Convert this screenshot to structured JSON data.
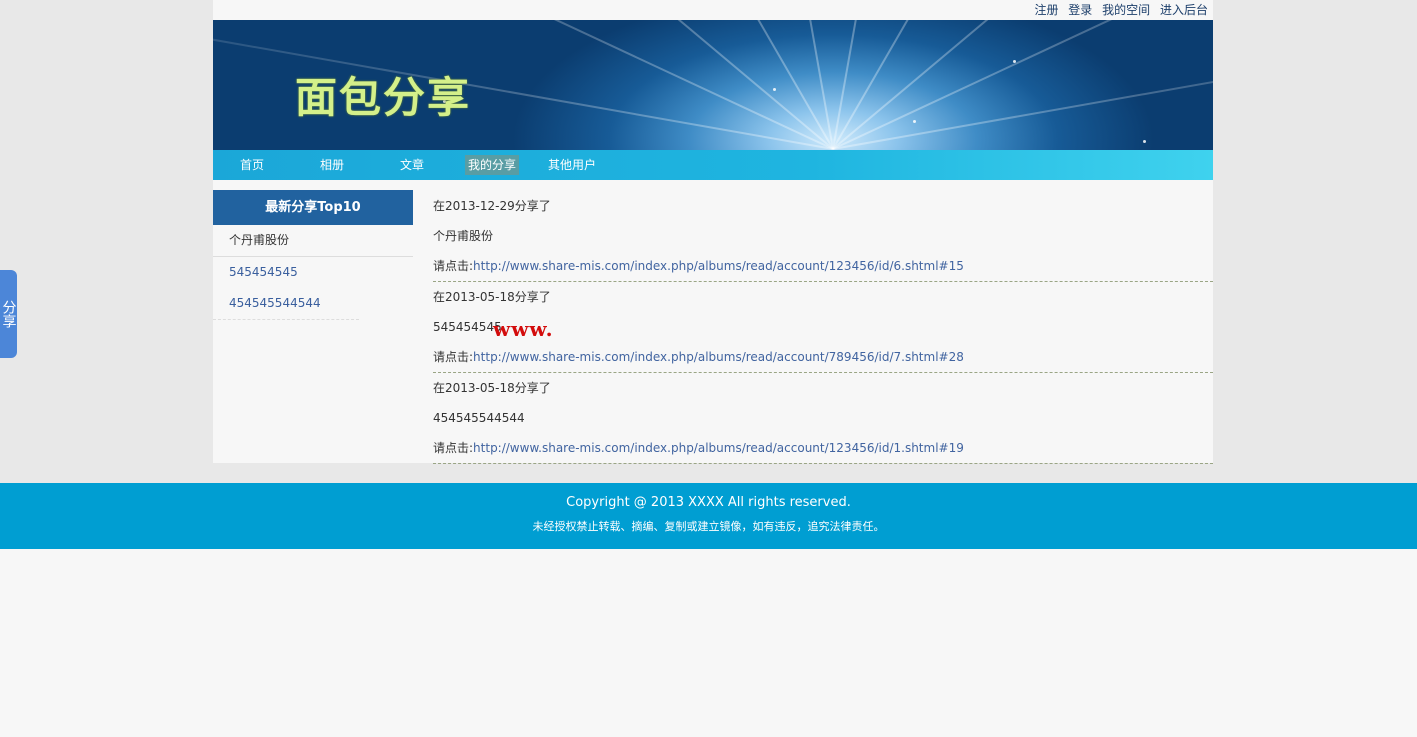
{
  "topbar": {
    "links": [
      "注册",
      "登录",
      "我的空间",
      "进入后台"
    ]
  },
  "banner": {
    "logo_text": "面包分享"
  },
  "nav": {
    "items": [
      "首页",
      "相册",
      "文章",
      "我的分享",
      "其他用户"
    ],
    "active_index": 3
  },
  "sidebar": {
    "title": "最新分享Top10",
    "items": [
      "个丹甫股份",
      "545454545",
      "454545544544"
    ]
  },
  "entries": [
    {
      "date_line": "在2013-12-29分享了",
      "name": "个丹甫股份",
      "link_prefix": "请点击:",
      "link": "http://www.share-mis.com/index.php/albums/read/account/123456/id/6.shtml#15"
    },
    {
      "date_line": "在2013-05-18分享了",
      "name": "545454545",
      "link_prefix": "请点击:",
      "link": "http://www.share-mis.com/index.php/albums/read/account/789456/id/7.shtml#28"
    },
    {
      "date_line": "在2013-05-18分享了",
      "name": "454545544544",
      "link_prefix": "请点击:",
      "link": "http://www.share-mis.com/index.php/albums/read/account/123456/id/1.shtml#19"
    }
  ],
  "watermark": "www.",
  "footer": {
    "copyright": "Copyright @ 2013 XXXX All rights reserved.",
    "notice": "未经授权禁止转载、摘编、复制或建立镜像，如有违反，追究法律责任。"
  },
  "share_tab": {
    "label": "分享"
  },
  "colors": {
    "nav": "#1fb5e0",
    "sidebar_title": "#21629f",
    "footer": "#009ed2",
    "link": "#4164a0",
    "watermark": "#d30c0c"
  }
}
